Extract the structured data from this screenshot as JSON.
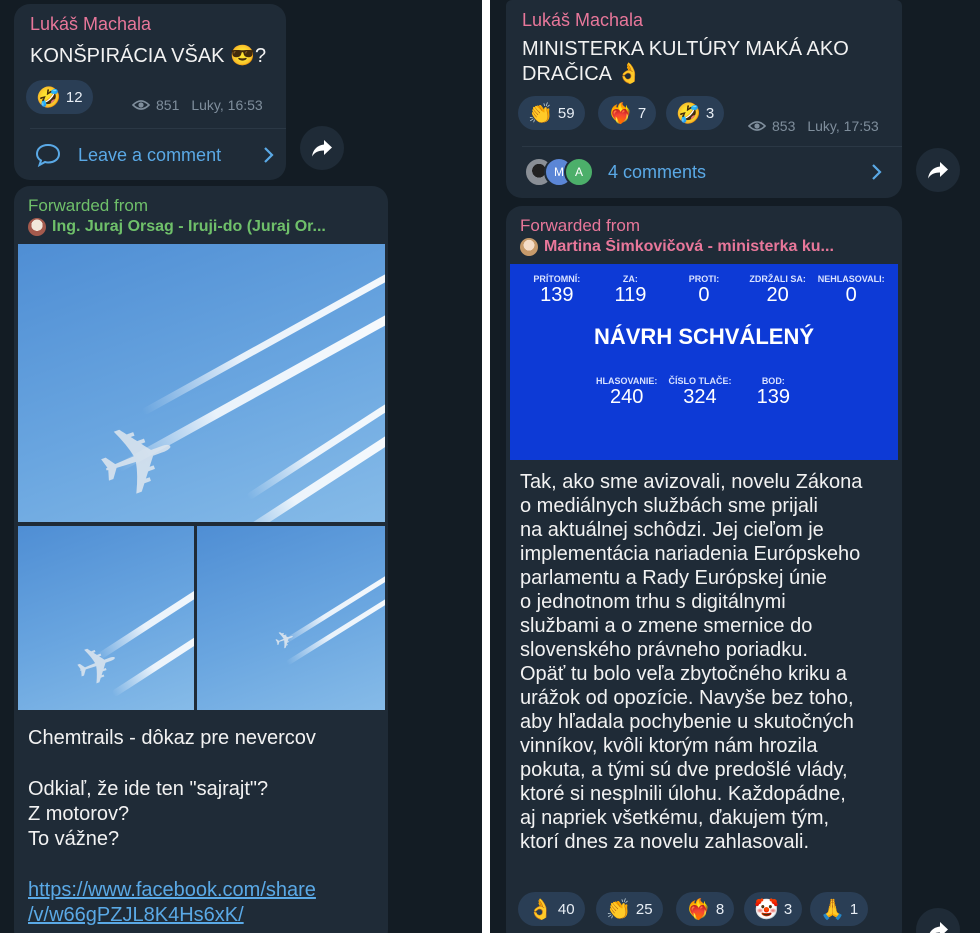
{
  "left": {
    "msg1": {
      "author": "Lukáš Machala",
      "text": "KONŠPIRÁCIA VŠAK 😎?",
      "reactions": [
        {
          "emoji": "🤣",
          "count": "12"
        }
      ],
      "views": "851",
      "time": "Luky, 16:53",
      "comment_label": "Leave a comment"
    },
    "msg2": {
      "forwarded_label": "Forwarded from",
      "source": "Ing. Juraj Orsag - Iruji-do (Juraj Or...",
      "caption": "Chemtrails - dôkaz pre nevercov",
      "body": [
        "Odkiaľ, že ide ten \"sajrajt\"?",
        "Z motorov?",
        "To vážne?"
      ],
      "link": [
        "https://www.facebook.com/share",
        "/v/w66gPZJL8K4Hs6xK/"
      ]
    }
  },
  "right": {
    "msg1": {
      "author": "Lukáš Machala",
      "text_lines": [
        "MINISTERKA KULTÚRY MAKÁ AKO",
        "DRAČICA 👌"
      ],
      "reactions": [
        {
          "emoji": "👏",
          "count": "59"
        },
        {
          "emoji": "❤️‍🔥",
          "count": "7"
        },
        {
          "emoji": "🤣",
          "count": "3"
        }
      ],
      "views": "853",
      "time": "Luky, 17:53",
      "comments_label": "4 comments",
      "commenter_initials": [
        "M",
        "A"
      ]
    },
    "msg2": {
      "forwarded_label": "Forwarded from",
      "source": "Martina Šimkovičová - ministerka ku...",
      "vote": {
        "top": [
          {
            "label": "PRÍTOMNÍ:",
            "value": "139"
          },
          {
            "label": "ZA:",
            "value": "119"
          },
          {
            "label": "PROTI:",
            "value": "0"
          },
          {
            "label": "ZDRŽALI SA:",
            "value": "20"
          },
          {
            "label": "NEHLASOVALI:",
            "value": "0"
          }
        ],
        "result": "NÁVRH SCHVÁLENÝ",
        "bottom": [
          {
            "label": "HLASOVANIE:",
            "value": "240"
          },
          {
            "label": "ČÍSLO TLAČE:",
            "value": "324"
          },
          {
            "label": "BOD:",
            "value": "139"
          }
        ]
      },
      "body": [
        "Tak, ako sme avizovali, novelu Zákona",
        "o mediálnych službách sme prijali",
        "na aktuálnej schôdzi. Jej cieľom je",
        "implementácia nariadenia Európskeho",
        "parlamentu a Rady Európskej únie",
        "o jednotnom trhu s digitálnymi",
        "službami a o zmene smernice do",
        "slovenského právneho poriadku.",
        "Opäť tu bolo veľa zbytočného kriku a",
        "urážok od opozície. Navyše bez toho,",
        "aby hľadala pochybenie u skutočných",
        "vinníkov, kvôli ktorým nám hrozila",
        "pokuta,  a tými sú dve predošlé vlády,",
        "ktoré si nesplnili úlohu. Každopádne,",
        "aj napriek všetkému, ďakujem tým,",
        "ktorí dnes za novelu zahlasovali."
      ],
      "reactions": [
        {
          "emoji": "👌",
          "count": "40"
        },
        {
          "emoji": "👏",
          "count": "25"
        },
        {
          "emoji": "❤️‍🔥",
          "count": "8"
        },
        {
          "emoji": "🤡",
          "count": "3"
        },
        {
          "emoji": "🙏",
          "count": "1"
        }
      ]
    }
  },
  "colors": {
    "accent_link": "#5aa9e6",
    "forward_green": "#6fc06a",
    "author_pink": "#e8779a",
    "vote_blue": "#0d3ad6"
  },
  "icons": [
    "eye-icon",
    "comment-bubble-icon",
    "chevron-right-icon",
    "share-arrow-icon"
  ]
}
